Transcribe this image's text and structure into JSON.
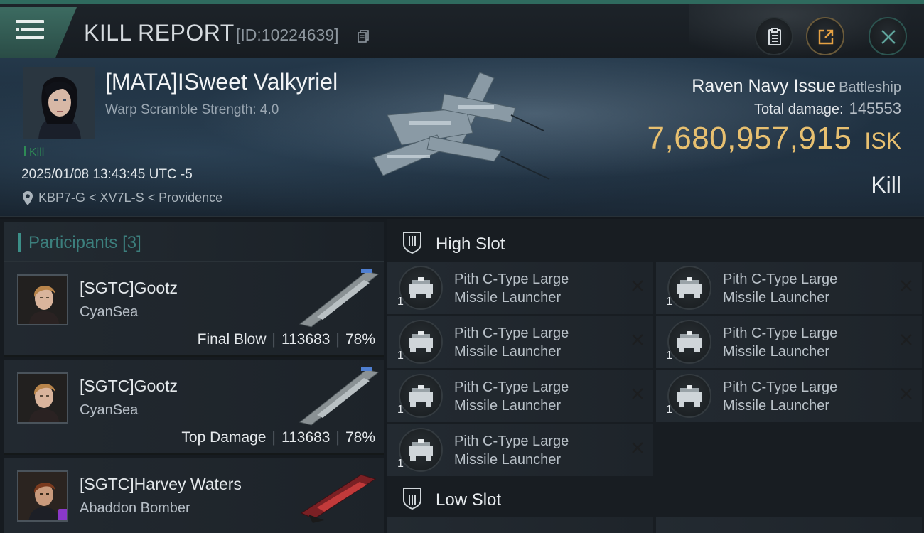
{
  "header": {
    "title": "KILL REPORT",
    "report_id": "[ID:10224639]"
  },
  "victim": {
    "name": "[MATA]ISweet Valkyriel",
    "warp_scramble": "Warp Scramble Strength: 4.0",
    "kill_tag": "Kill",
    "datetime": "2025/01/08 13:43:45 UTC -5",
    "location": "KBP7-G < XV7L-S < Providence",
    "ship_name": "Raven Navy Issue",
    "ship_class": "Battleship",
    "total_damage_label": "Total damage:",
    "total_damage_value": "145553",
    "isk_value": "7,680,957,915",
    "isk_unit": "ISK",
    "result": "Kill"
  },
  "participants": {
    "label": "Participants",
    "count": "[3]",
    "items": [
      {
        "name": "[SGTC]Gootz",
        "ship": "CyanSea",
        "role": "Final Blow",
        "damage": "113683",
        "percent": "78%"
      },
      {
        "name": "[SGTC]Gootz",
        "ship": "CyanSea",
        "role": "Top Damage",
        "damage": "113683",
        "percent": "78%"
      },
      {
        "name": "[SGTC]Harvey Waters",
        "ship": "Abaddon Bomber"
      }
    ]
  },
  "high_slot": {
    "label": "High Slot",
    "modules": [
      {
        "line1": "Pith C-Type Large",
        "line2": "Missile Launcher",
        "qty": "1"
      },
      {
        "line1": "Pith C-Type Large",
        "line2": "Missile Launcher",
        "qty": "1"
      },
      {
        "line1": "Pith C-Type Large",
        "line2": "Missile Launcher",
        "qty": "1"
      },
      {
        "line1": "Pith C-Type Large",
        "line2": "Missile Launcher",
        "qty": "1"
      },
      {
        "line1": "Pith C-Type Large",
        "line2": "Missile Launcher",
        "qty": "1"
      },
      {
        "line1": "Pith C-Type Large",
        "line2": "Missile Launcher",
        "qty": "1"
      },
      {
        "line1": "Pith C-Type Large",
        "line2": "Missile Launcher",
        "qty": "1"
      }
    ]
  },
  "low_slot": {
    "label": "Low Slot"
  },
  "colors": {
    "accent_teal": "#3c8f88",
    "isk_gold": "#e8c070",
    "kill_green": "#2e8a55"
  },
  "icons": [
    "menu-icon",
    "copy-icon",
    "clipboard-icon",
    "share-icon",
    "close-icon",
    "location-pin-icon",
    "slot-shield-icon",
    "module-icon",
    "remove-x-icon"
  ]
}
